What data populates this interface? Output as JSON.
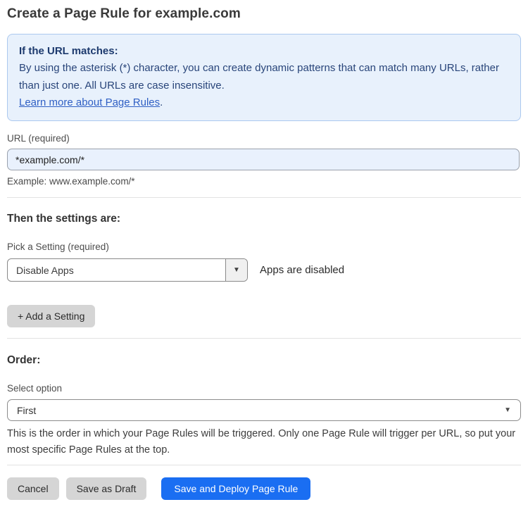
{
  "page": {
    "title": "Create a Page Rule for example.com"
  },
  "info_box": {
    "heading": "If the URL matches:",
    "body": "By using the asterisk (*) character, you can create dynamic patterns that can match many URLs, rather than just one. All URLs are case insensitive.",
    "link_label": "Learn more about Page Rules",
    "link_suffix": "."
  },
  "url_field": {
    "label": "URL (required)",
    "value": "*example.com/*",
    "example": "Example: www.example.com/*"
  },
  "settings_section": {
    "heading": "Then the settings are:",
    "picker_label": "Pick a Setting (required)",
    "selected_setting": "Disable Apps",
    "setting_status": "Apps are disabled",
    "add_setting_label": "+ Add a Setting"
  },
  "order_section": {
    "heading": "Order:",
    "select_label": "Select option",
    "selected_option": "First",
    "help_text": "This is the order in which your Page Rules will be triggered. Only one Page Rule will trigger per URL, so put your most specific Page Rules at the top."
  },
  "footer": {
    "cancel_label": "Cancel",
    "save_draft_label": "Save as Draft",
    "save_deploy_label": "Save and Deploy Page Rule"
  },
  "icons": {
    "caret_down": "▼"
  },
  "colors": {
    "accent_blue": "#1a6ef2",
    "info_box_bg": "#e8f1fc",
    "info_box_border": "#abc8ef",
    "info_text": "#29457a",
    "link_blue": "#2f5fc4",
    "input_bg": "#e9f1fd",
    "button_gray": "#d5d5d5"
  }
}
